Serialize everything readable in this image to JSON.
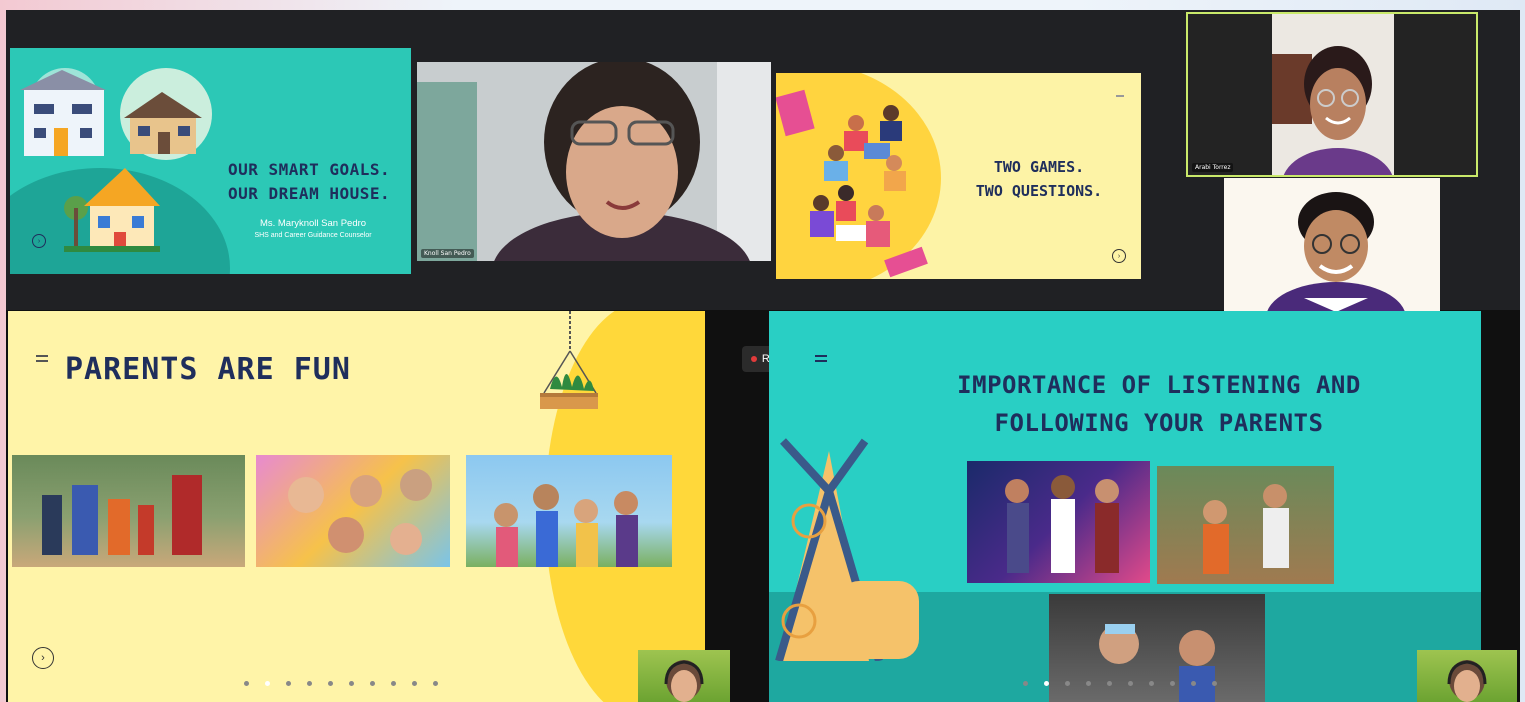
{
  "slides": {
    "goals": {
      "title_line1": "OUR SMART GOALS.",
      "title_line2": "OUR DREAM HOUSE.",
      "presenter": "Ms. Maryknoll San Pedro",
      "role": "SHS and Career Guidance Counselor"
    },
    "games": {
      "title_line1": "TWO GAMES.",
      "title_line2": "TWO QUESTIONS."
    },
    "parents": {
      "heading": "PARENTS ARE FUN",
      "nav_icon": "chevron-right-icon"
    },
    "listening": {
      "heading_line1": "IMPORTANCE OF LISTENING AND",
      "heading_line2": "FOLLOWING YOUR PARENTS"
    }
  },
  "participants": {
    "main_cam_label": "Knoll San Pedro",
    "top_right_label": "Arabi Torrez"
  },
  "recording": {
    "label": "REC"
  },
  "colors": {
    "teal": "#2cc8b6",
    "yellow_light": "#fff4a8",
    "yellow": "#ffd43f",
    "navy_text": "#1f2e5c",
    "rec_red": "#e23b3b"
  },
  "pagination": {
    "total": 10,
    "left_active": 1,
    "right_active": 1
  }
}
